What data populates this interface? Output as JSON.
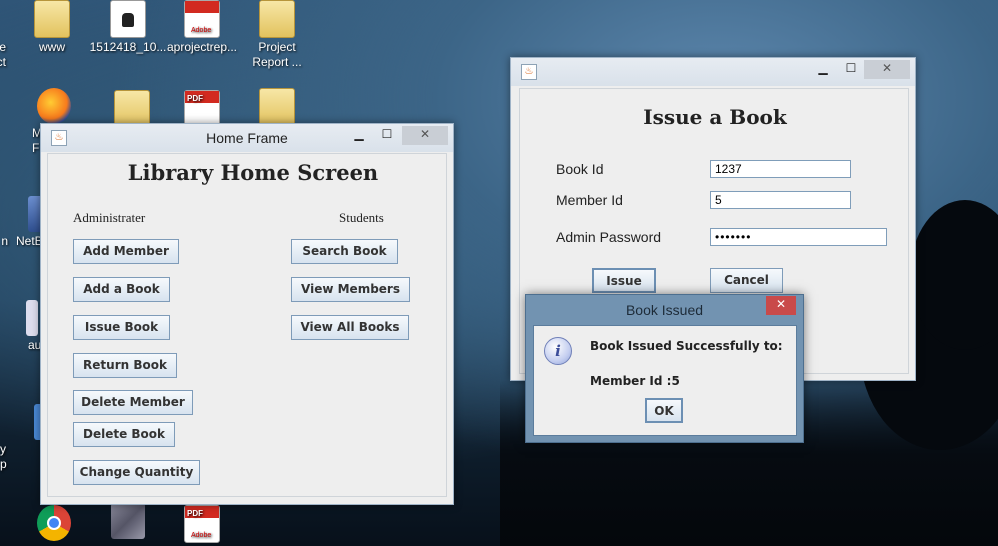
{
  "desktop": {
    "icons": [
      {
        "label": "re\nct"
      },
      {
        "label": "www"
      },
      {
        "label": "1512418_10..."
      },
      {
        "label": "aprojectrep..."
      },
      {
        "label": "Project\nReport ..."
      },
      {
        "label": "M\nF"
      },
      {
        "label": "n"
      },
      {
        "label": "NetB"
      },
      {
        "label": "au"
      },
      {
        "label": "y\np"
      }
    ],
    "pdf_badge": "PDF",
    "adobe_text": "Adobe"
  },
  "home_frame": {
    "title": "Home Frame",
    "heading": "Library Home Screen",
    "admin_label": "Administrater",
    "students_label": "Students",
    "admin_buttons": [
      "Add Member",
      "Add a Book",
      "Issue Book",
      "Return Book",
      "Delete Member",
      "Delete Book",
      "Change Quantity"
    ],
    "student_buttons": [
      "Search Book",
      "View Members",
      "View All Books"
    ],
    "minimize": "▁",
    "maximize": "☐",
    "close": "✕"
  },
  "issue_frame": {
    "heading": "Issue a Book",
    "book_id_label": "Book Id",
    "book_id_value": "1237",
    "member_id_label": "Member Id",
    "member_id_value": "5",
    "password_label": "Admin Password",
    "password_value": "•••••••",
    "issue_button": "Issue",
    "cancel_button": "Cancel",
    "minimize": "▁",
    "maximize": "☐",
    "close": "✕"
  },
  "dialog": {
    "title": "Book Issued",
    "message_line1": "Book Issued Successfully to:",
    "message_line2": "Member Id :5",
    "ok_button": "OK",
    "close": "✕",
    "icon_glyph": "i"
  },
  "colors": {
    "window_bg": "#eeeeee",
    "button_border": "#7e9bb8",
    "dialog_frame": "#7293b1",
    "close_red": "#c94a4a"
  }
}
